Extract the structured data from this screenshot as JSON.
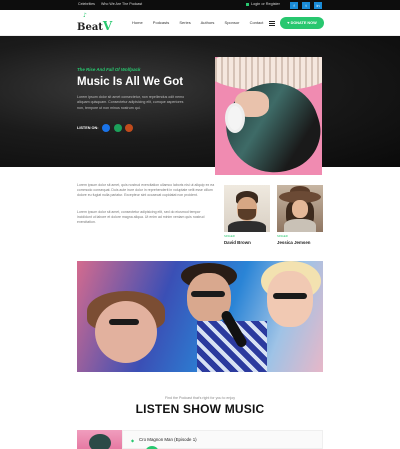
{
  "topbar": {
    "links": [
      "Celebrities",
      "Who We Are",
      "The Podcast"
    ],
    "login": "Login or Register",
    "socials": [
      "f",
      "t",
      "in"
    ]
  },
  "nav": {
    "logo": "Beat",
    "logo_suffix": "V",
    "links": [
      "Home",
      "Podcasts",
      "Series",
      "Authors",
      "Sponsor",
      "Contact"
    ],
    "donate": "DONATE NOW"
  },
  "hero": {
    "tagline": "The Rise And Fall Of Wolfpack",
    "title": "Music Is All We Got",
    "description": "Lorem ipsum dolor sit amet consectetur, non repellendus odit nemo aliquam quisquam. Consectetur adipisicing elit, cumque asperiores non, tempore ut non minus nostrum qui.",
    "listen_label": "LISTEN ON:"
  },
  "about": {
    "paragraph1": "Lorem ipsum dolor sit amet, quis nostrud exercitation ullamco laboris nisi ut aliquip ex ea commodo consequat. Duis aute irure dolor in reprehenderit in voluptate velit esse cillum dolore eu fugiat nulla pariatur. Excepteur sint occaecat cupidatat non proident.",
    "paragraph2": "Lorem ipsum dolor sit amet, consectetur adipisicing elit, sed do eiusmod tempor incididunt ut labore et dolore magna aliqua. Ut enim ad minim veniam quis nostrud exercitation."
  },
  "artists": [
    {
      "meta": "SINGER",
      "name": "David Brown"
    },
    {
      "meta": "SINGER",
      "name": "Jessica Jemsen"
    }
  ],
  "show": {
    "caption": "Find the Podcast that's right for you to enjoy",
    "title": "LISTEN SHOW MUSIC"
  },
  "tracks": [
    {
      "name": "Cro Magnon Man (Episode 1)"
    }
  ],
  "colors": {
    "accent": "#28c76f",
    "hero_bg": "#111111",
    "hero_photo_bg": "#f08bb1"
  }
}
